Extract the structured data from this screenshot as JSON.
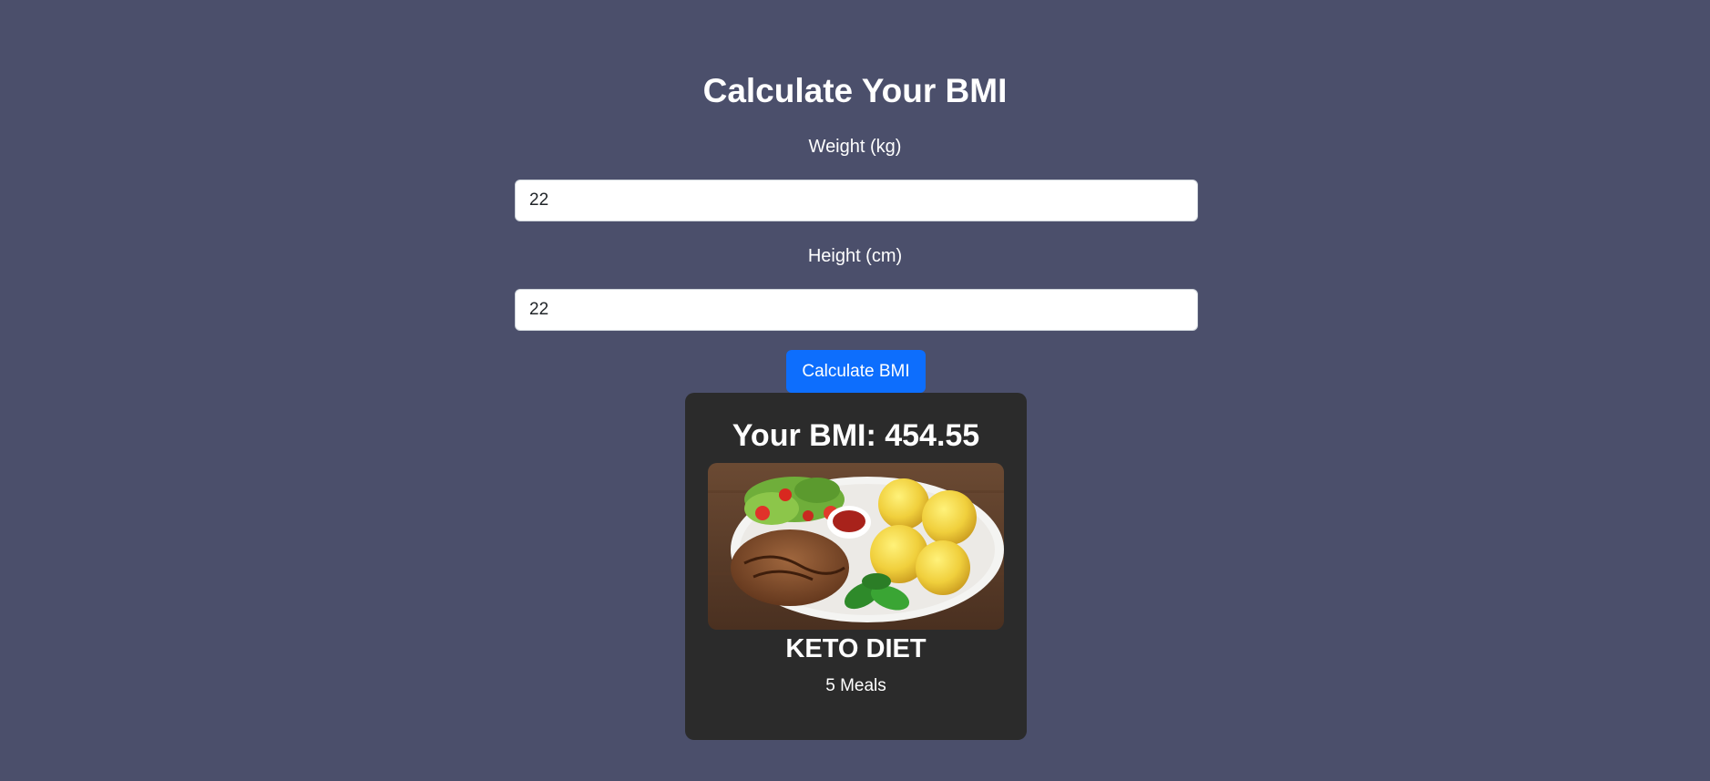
{
  "page": {
    "title": "Calculate Your BMI"
  },
  "form": {
    "weight_label": "Weight (kg)",
    "weight_value": "22",
    "height_label": "Height (cm)",
    "height_value": "22",
    "submit_label": "Calculate BMI"
  },
  "result": {
    "bmi_text": "Your BMI: 454.55",
    "diet_name": "KETO DIET",
    "meals": "5 Meals",
    "image_description": "food-plate-image"
  },
  "colors": {
    "background": "#4b4f6b",
    "card": "#2b2b2b",
    "button": "#0d6efd",
    "text": "#ffffff"
  }
}
